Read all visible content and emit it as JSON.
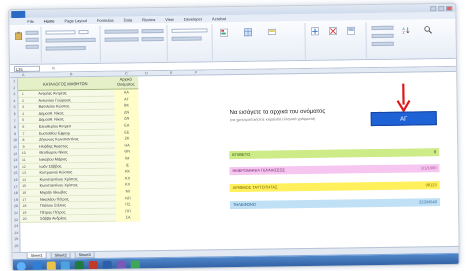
{
  "ribbon": {
    "tabs": [
      "File",
      "Home",
      "Page Layout",
      "Formulas",
      "Data",
      "Review",
      "View",
      "Developer",
      "Acrobat"
    ]
  },
  "formula_bar": {
    "cell": "L25",
    "fx": "fx"
  },
  "list": {
    "header_name": "ΚΑΤΑΛΟΓΟΣ ΜΑΘΗΤΩΝ",
    "header_initials": "Αρχικά Ονόματος",
    "rows": [
      {
        "n": "1",
        "name": "Αντρέας Αντρέας",
        "ini": "ΑΑ"
      },
      {
        "n": "2",
        "name": "Αντωνίου Γεώργιος",
        "ini": "ΑΓ"
      },
      {
        "n": "3",
        "name": "Βασιλείου Κώστας",
        "ini": "ΒΚ"
      },
      {
        "n": "4",
        "name": "Δημοσθ. Νίκος",
        "ini": "ΔΝ"
      },
      {
        "n": "5",
        "name": "Δημοσθ. Νίκος",
        "ini": "ΔΝ"
      },
      {
        "n": "6",
        "name": "Ελευθερίου Άντρεα",
        "ini": "ΕΑ"
      },
      {
        "n": "7",
        "name": "Ευσταθίου Έφρειμ",
        "ini": "ΕΕ"
      },
      {
        "n": "8",
        "name": "Ζήνωνος Κωνσταντίνος",
        "ini": "ΖΚ"
      },
      {
        "n": "9",
        "name": "Ηλιάδης Άκαστος",
        "ini": "ΗΑ"
      },
      {
        "n": "10",
        "name": "Θεοδώρου Νίκος",
        "ini": "ΘΝ"
      },
      {
        "n": "11",
        "name": "Ιακώβου Μάριος",
        "ini": "ΙΜ"
      },
      {
        "n": "12",
        "name": "Ιωάν Σάββας",
        "ini": "ΙΣ"
      },
      {
        "n": "13",
        "name": "Κυπριανού Κώστας",
        "ini": "ΚΚ"
      },
      {
        "n": "14",
        "name": "Κωνσταντίνου Χρίστος",
        "ini": "ΚΧ"
      },
      {
        "n": "15",
        "name": "Κωνσταντίνου Χρίστος",
        "ini": "ΚΧ"
      },
      {
        "n": "16",
        "name": "Μιχαήλ Ιάκωβος",
        "ini": "ΜΙ"
      },
      {
        "n": "17",
        "name": "Νικολάου Πέτρος",
        "ini": "ΝΠ"
      },
      {
        "n": "18",
        "name": "Παύλου Στέλιος",
        "ini": "ΠΣ"
      },
      {
        "n": "19",
        "name": "Πέτρου Πέτρος",
        "ini": "ΠΠ"
      },
      {
        "n": "20",
        "name": "Σάββα Ανδρέας",
        "ini": "ΣΑ"
      }
    ]
  },
  "instruction": {
    "title": "Να εισάγετε τα αρχικά του ονόματος",
    "subtitle": "(να χρησιμοποιήσετε κεφαλαία ελληνικά γράμματα)",
    "initials_value": "ΑΓ"
  },
  "fields": {
    "surname": {
      "label": "ΕΠΙΘΕΤΟ",
      "value": "0"
    },
    "dob": {
      "label": "ΗΜΕΡΟΜΗΝΙΑ ΓΕΝΝΗΣΕΩΣ",
      "value": "1/1/1900"
    },
    "id": {
      "label": "ΑΡΙΘΜΟΣ ΤΑΥΤΟΤΗΤΑΣ",
      "value": "98123"
    },
    "phone": {
      "label": "ΤΗΛΕΦΩΝΟ",
      "value": "22334540"
    }
  },
  "sheets": [
    "Sheet1",
    "Sheet2",
    "Sheet3"
  ],
  "colors": {
    "initials_box": "#1f62d6",
    "arrow": "#e01818",
    "surname_band": "#cdeb86",
    "dob_band": "#f6c6f1",
    "id_band": "#fff05c",
    "phone_band": "#bfe0f5"
  }
}
